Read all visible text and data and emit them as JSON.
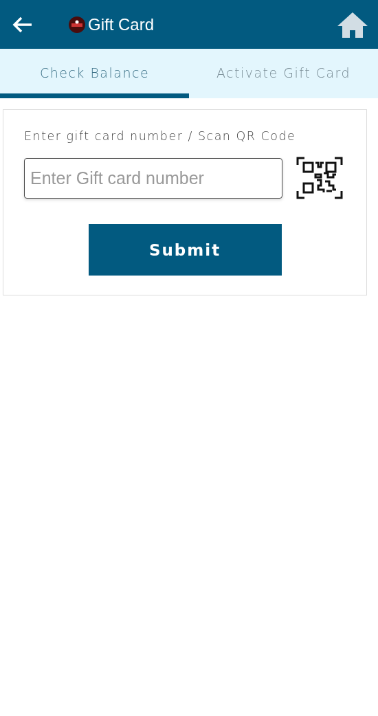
{
  "header": {
    "title": "Gift Card"
  },
  "tabs": [
    {
      "label": "Check Balance",
      "selected": true
    },
    {
      "label": "Activate Gift Card",
      "selected": false
    }
  ],
  "form": {
    "label": "Enter gift card number / Scan QR Code",
    "field": {
      "placeholder": "Enter Gift card number"
    },
    "button": "Submit"
  }
}
